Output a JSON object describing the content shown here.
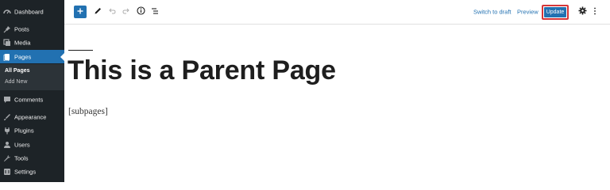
{
  "sidebar": {
    "items": [
      {
        "label": "Dashboard",
        "icon": "dashboard-icon"
      },
      {
        "label": "Posts",
        "icon": "pin-icon"
      },
      {
        "label": "Media",
        "icon": "media-icon"
      },
      {
        "label": "Pages",
        "icon": "pages-icon"
      },
      {
        "label": "Comments",
        "icon": "comments-icon"
      },
      {
        "label": "Appearance",
        "icon": "appearance-icon"
      },
      {
        "label": "Plugins",
        "icon": "plugins-icon"
      },
      {
        "label": "Users",
        "icon": "users-icon"
      },
      {
        "label": "Tools",
        "icon": "tools-icon"
      },
      {
        "label": "Settings",
        "icon": "settings-icon"
      }
    ],
    "pages_submenu": {
      "all_pages": "All Pages",
      "add_new": "Add New"
    }
  },
  "toolbar": {
    "icons": [
      "plus-icon",
      "pencil-icon",
      "undo-icon",
      "redo-icon",
      "info-icon",
      "list-view-icon",
      "gear-icon",
      "more-vertical-icon"
    ],
    "switch_to_draft": "Switch to draft",
    "preview": "Preview",
    "update": "Update"
  },
  "editor": {
    "title": "This is a Parent Page",
    "paragraph": "[subpages]"
  },
  "colors": {
    "sidebar_bg": "#1d2327",
    "accent": "#2271b1",
    "highlight_border": "#d63638"
  }
}
